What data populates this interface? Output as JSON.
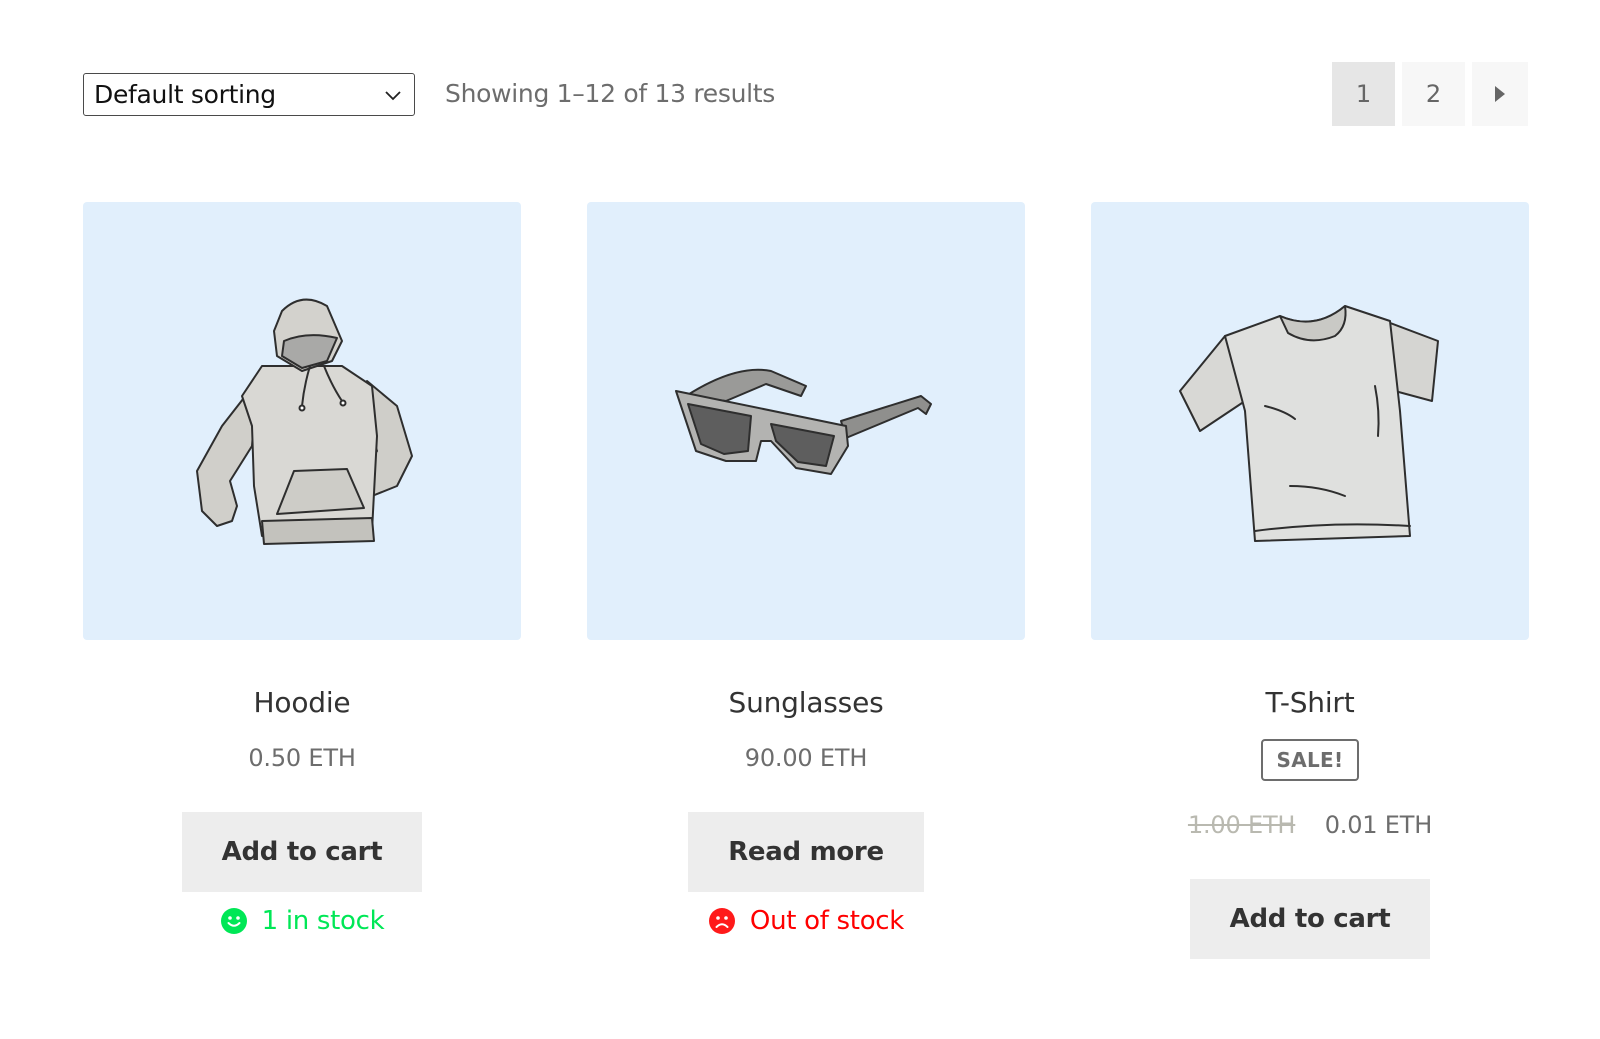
{
  "toolbar": {
    "sort": {
      "selected": "Default sorting",
      "icon": "chevron-down-icon"
    },
    "result_count": "Showing 1–12 of 13 results",
    "pagination": {
      "pages": [
        "1",
        "2"
      ],
      "current": "1",
      "next_icon": "triangle-right-icon"
    }
  },
  "colors": {
    "thumb_bg": "#e1effc",
    "in_stock": "#00e756",
    "out_of_stock": "#ff0000",
    "button_bg": "#ededed"
  },
  "products": [
    {
      "name": "Hoodie",
      "image": "hoodie-illustration",
      "price": "0.50 ETH",
      "button": "Add to cart",
      "stock": {
        "status": "in-stock",
        "text": "1 in stock",
        "icon": "smiley-icon"
      }
    },
    {
      "name": "Sunglasses",
      "image": "sunglasses-illustration",
      "price": "90.00 ETH",
      "button": "Read more",
      "stock": {
        "status": "out-of-stock",
        "text": "Out of stock",
        "icon": "frown-icon"
      }
    },
    {
      "name": "T-Shirt",
      "image": "tshirt-illustration",
      "sale_badge": "SALE!",
      "regular_price": "1.00 ETH",
      "sale_price": "0.01 ETH",
      "button": "Add to cart"
    }
  ]
}
